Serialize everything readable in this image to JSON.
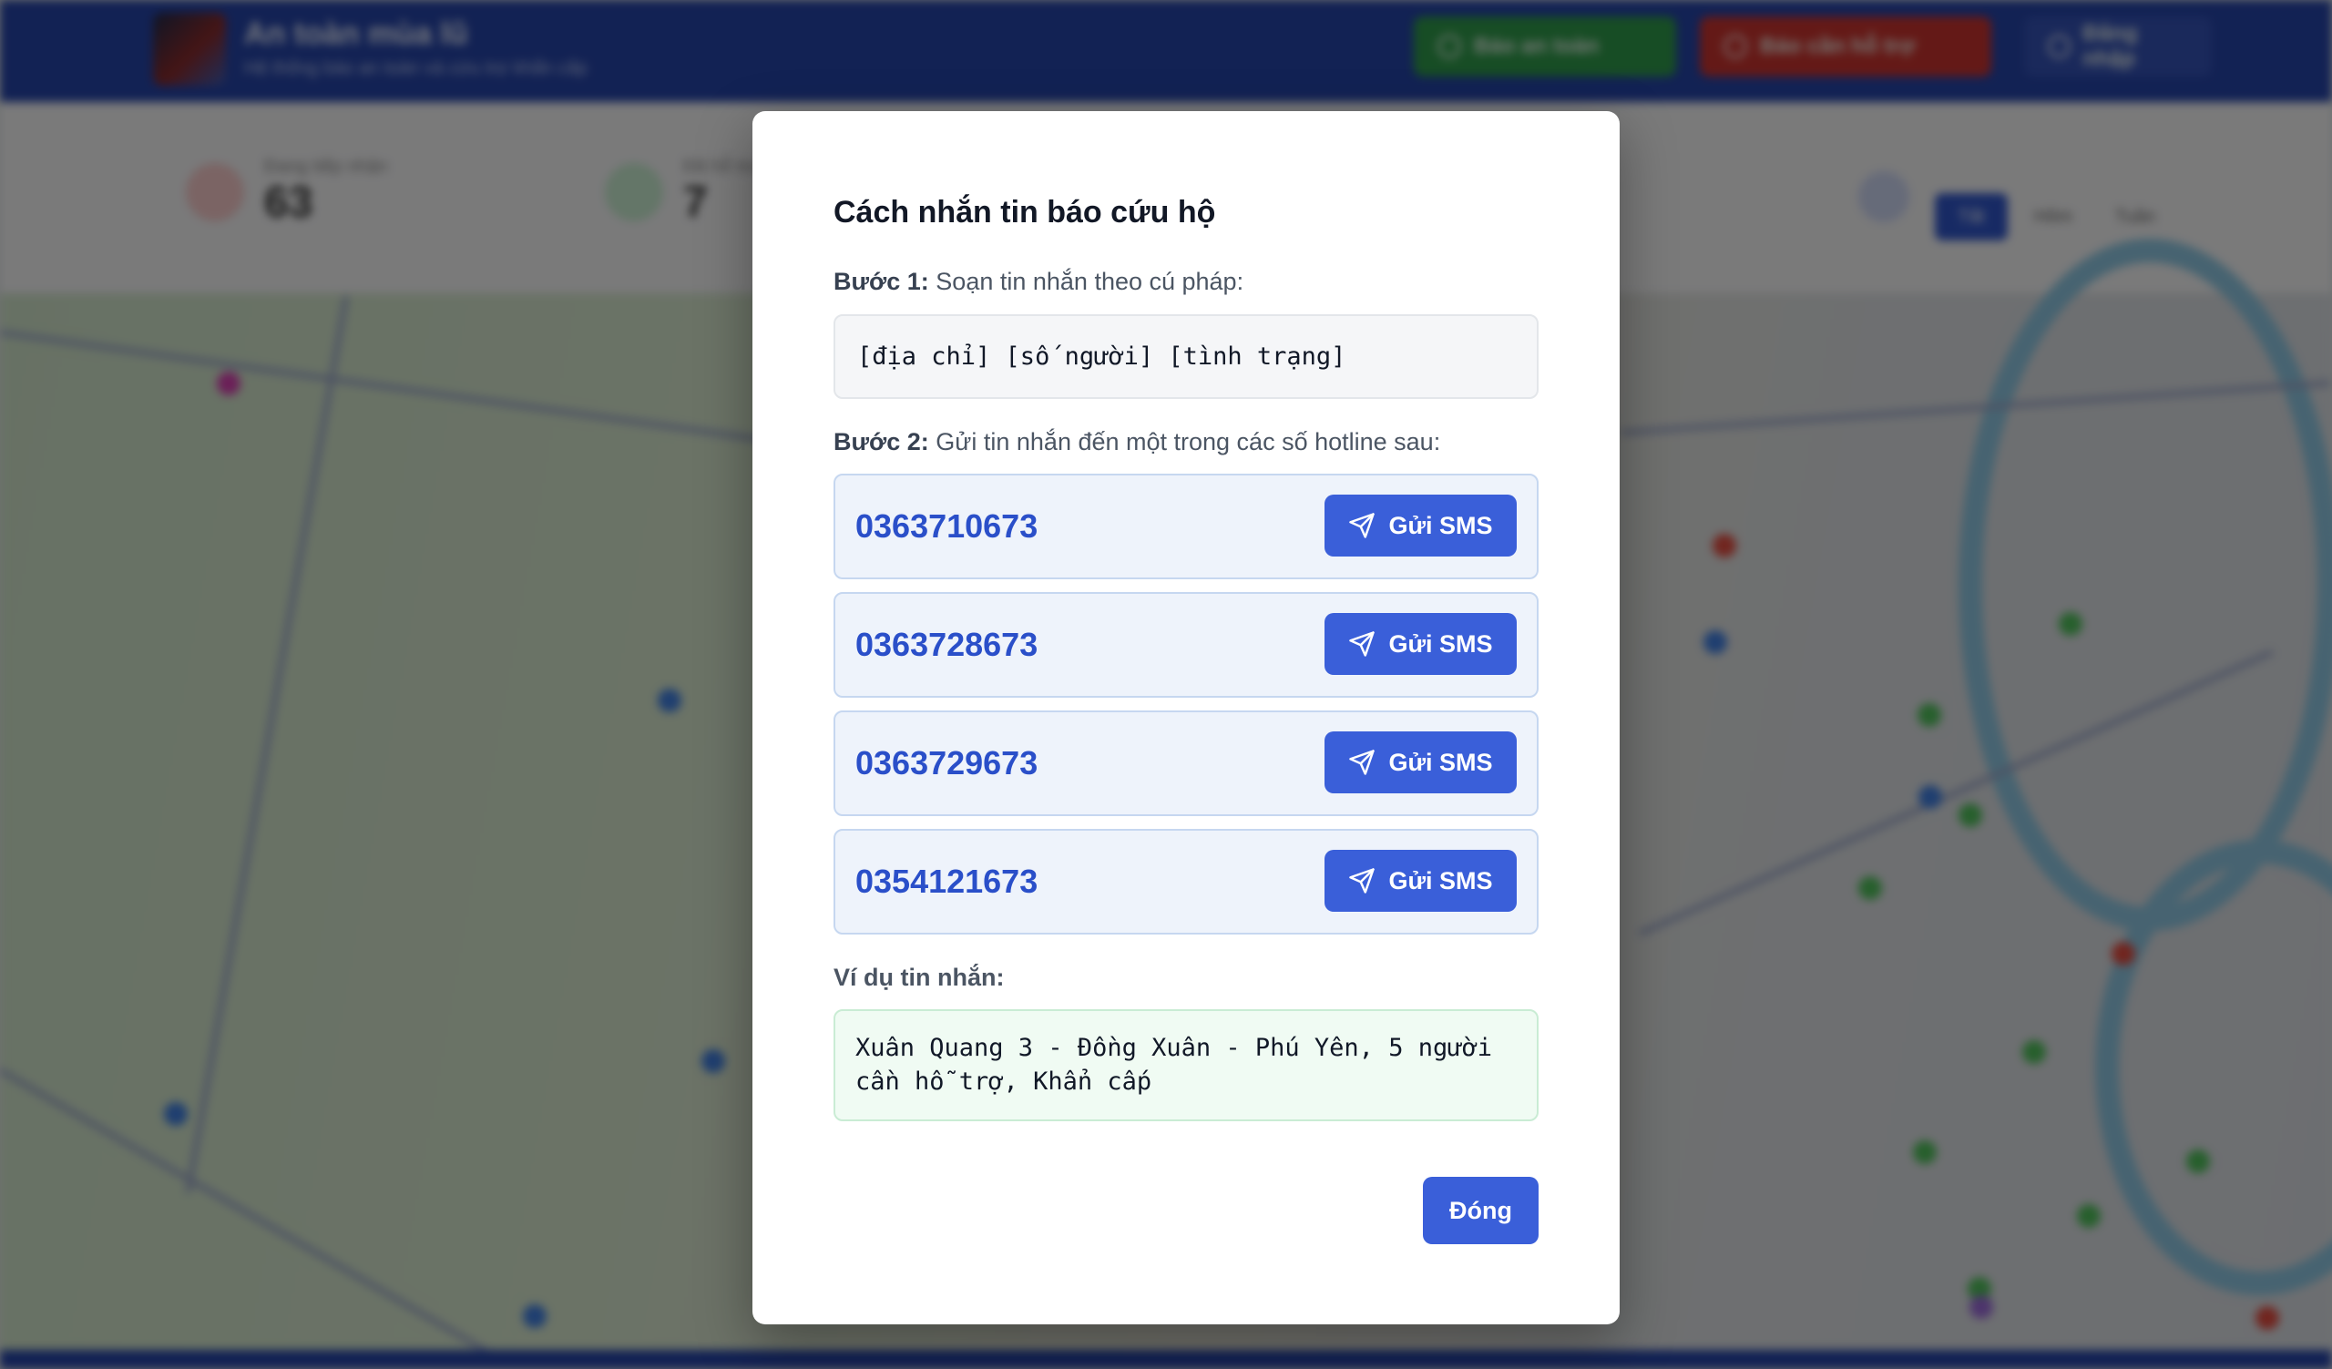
{
  "app": {
    "title": "An toàn mùa lũ",
    "subtitle": "Hệ thống báo an toàn và cứu trợ khẩn cấp",
    "buttons": {
      "safe": "Báo an toàn",
      "help": "Báo cần hỗ trợ",
      "login": "Đăng nhập"
    }
  },
  "stats": [
    {
      "label": "Đang tiếp nhận",
      "value": "63"
    },
    {
      "label": "Đã hỗ trợ",
      "value": "7"
    }
  ],
  "scope": [
    "Tất",
    "Hôm",
    "Tuần"
  ],
  "modal": {
    "title": "Cách nhắn tin báo cứu hộ",
    "step1_label": "Bước 1:",
    "step1_text": "Soạn tin nhắn theo cú pháp:",
    "syntax": "[địa chỉ] [số người] [tình trạng]",
    "step2_label": "Bước 2:",
    "step2_text": "Gửi tin nhắn đến một trong các số hotline sau:",
    "hotlines": [
      {
        "number": "0363710673",
        "button": "Gửi SMS"
      },
      {
        "number": "0363728673",
        "button": "Gửi SMS"
      },
      {
        "number": "0363729673",
        "button": "Gửi SMS"
      },
      {
        "number": "0354121673",
        "button": "Gửi SMS"
      }
    ],
    "example_label": "Ví dụ tin nhắn:",
    "example_text": "Xuân Quang 3 - Đồng Xuân - Phú Yên, 5 người cần hỗ trợ, Khẩn cấp",
    "close_button": "Đóng"
  },
  "colors": {
    "primary": "#3a5fd9",
    "hotline_text": "#2a4fc9",
    "header_bg": "#2544a8",
    "safe": "#2f9a4a",
    "help": "#c9332e"
  },
  "icons": {
    "sms": "send-icon"
  }
}
